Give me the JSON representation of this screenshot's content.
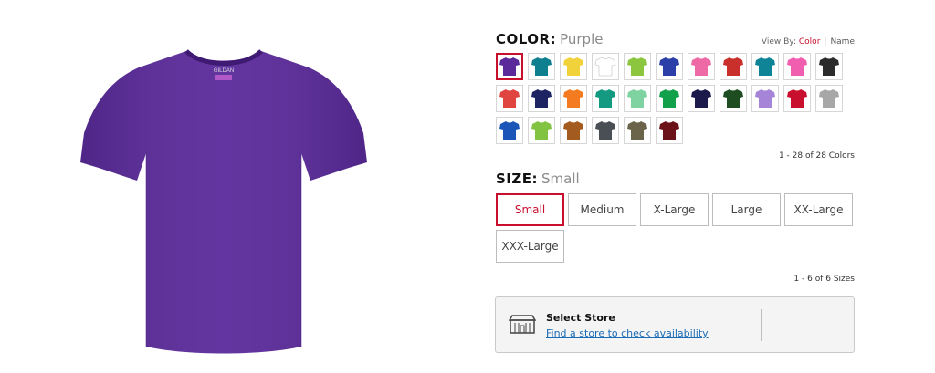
{
  "product": {
    "image_alt": "Purple short-sleeve t-shirt",
    "shirt_color": "#5a2a9a",
    "tag_text": "GILDAN"
  },
  "color_section": {
    "label": "COLOR:",
    "selected_value": "Purple",
    "view_by_label": "View By:",
    "view_by_active": "Color",
    "view_by_other": "Name",
    "count_text": "1 - 28 of 28 Colors",
    "swatches": [
      {
        "color": "#5a2a9a",
        "selected": true
      },
      {
        "color": "#0e7f8f"
      },
      {
        "color": "#f2d23a"
      },
      {
        "color": "#ffffff"
      },
      {
        "color": "#8cc63f"
      },
      {
        "color": "#2c3fa8"
      },
      {
        "color": "#ee6aa7"
      },
      {
        "color": "#c9302c"
      },
      {
        "color": "#0f8497"
      },
      {
        "color": "#f15eb0"
      },
      {
        "color": "#2b2b2b"
      },
      {
        "color": "#e0453f"
      },
      {
        "color": "#1d2461"
      },
      {
        "color": "#f57b20"
      },
      {
        "color": "#149a80"
      },
      {
        "color": "#7fd3a0"
      },
      {
        "color": "#12a14a"
      },
      {
        "color": "#1c1a4a"
      },
      {
        "color": "#1f4d22"
      },
      {
        "color": "#a685d8"
      },
      {
        "color": "#c8102e"
      },
      {
        "color": "#a7a7a7"
      },
      {
        "color": "#1b55b8"
      },
      {
        "color": "#82c341"
      },
      {
        "color": "#a35b20"
      },
      {
        "color": "#4a4f55"
      },
      {
        "color": "#6b644a"
      },
      {
        "color": "#6b1218"
      }
    ]
  },
  "size_section": {
    "label": "SIZE:",
    "selected_value": "Small",
    "count_text": "1 - 6 of 6 Sizes",
    "sizes": [
      "Small",
      "Medium",
      "X-Large",
      "Large",
      "XX-Large",
      "XXX-Large"
    ]
  },
  "store": {
    "title": "Select Store",
    "link_text": "Find a store to check availability"
  }
}
